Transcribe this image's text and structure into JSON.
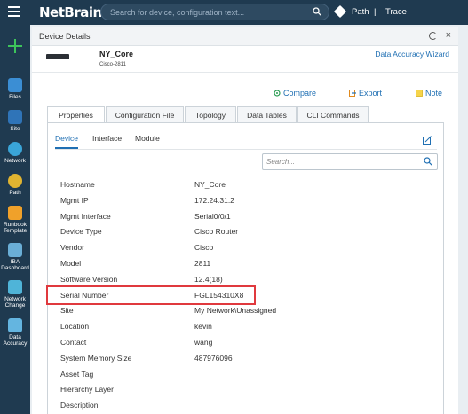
{
  "topbar": {
    "logo": "NetBrain",
    "search_placeholder": "Search for device, configuration text...",
    "path_label": "Path",
    "separator": "|",
    "trace_label": "Trace"
  },
  "sidebar": {
    "items": [
      {
        "label": "Files",
        "color": "#3b8ed4"
      },
      {
        "label": "Site",
        "color": "#2f74b8"
      },
      {
        "label": "Network",
        "color": "#3aa5d8"
      },
      {
        "label": "Path",
        "color": "#e0b431"
      },
      {
        "label": "Runbook Template",
        "color": "#f0a12a"
      },
      {
        "label": "IBA Dashboard",
        "color": "#6aaed6"
      },
      {
        "label": "Network Change",
        "color": "#4fb4d8"
      },
      {
        "label": "Data Accuracy",
        "color": "#64b5e0"
      }
    ]
  },
  "panel": {
    "title": "Device Details",
    "device_name": "NY_Core",
    "device_model": "Cisco-2811",
    "wizard_link": "Data Accuracy Wizard",
    "actions": {
      "compare": "Compare",
      "export": "Export",
      "note": "Note"
    },
    "tabs": [
      "Properties",
      "Configuration File",
      "Topology",
      "Data Tables",
      "CLI Commands"
    ],
    "subtabs": [
      "Device",
      "Interface",
      "Module"
    ],
    "search_placeholder": "Search...",
    "properties": [
      {
        "key": "Hostname",
        "value": "NY_Core"
      },
      {
        "key": "Mgmt IP",
        "value": "172.24.31.2"
      },
      {
        "key": "Mgmt Interface",
        "value": "Serial0/0/1"
      },
      {
        "key": "Device Type",
        "value": "Cisco Router"
      },
      {
        "key": "Vendor",
        "value": "Cisco"
      },
      {
        "key": "Model",
        "value": "2811"
      },
      {
        "key": "Software Version",
        "value": "12.4(18)"
      },
      {
        "key": "Serial Number",
        "value": "FGL154310X8"
      },
      {
        "key": "Site",
        "value": "My Network\\Unassigned"
      },
      {
        "key": "Location",
        "value": "kevin"
      },
      {
        "key": "Contact",
        "value": "wang"
      },
      {
        "key": "System Memory Size",
        "value": "487976096"
      },
      {
        "key": "Asset Tag",
        "value": ""
      },
      {
        "key": "Hierarchy Layer",
        "value": ""
      },
      {
        "key": "Description",
        "value": ""
      }
    ]
  },
  "colors": {
    "accent": "#1f6fb3",
    "nav_bg": "#1f3a50",
    "highlight": "#e0393e"
  }
}
